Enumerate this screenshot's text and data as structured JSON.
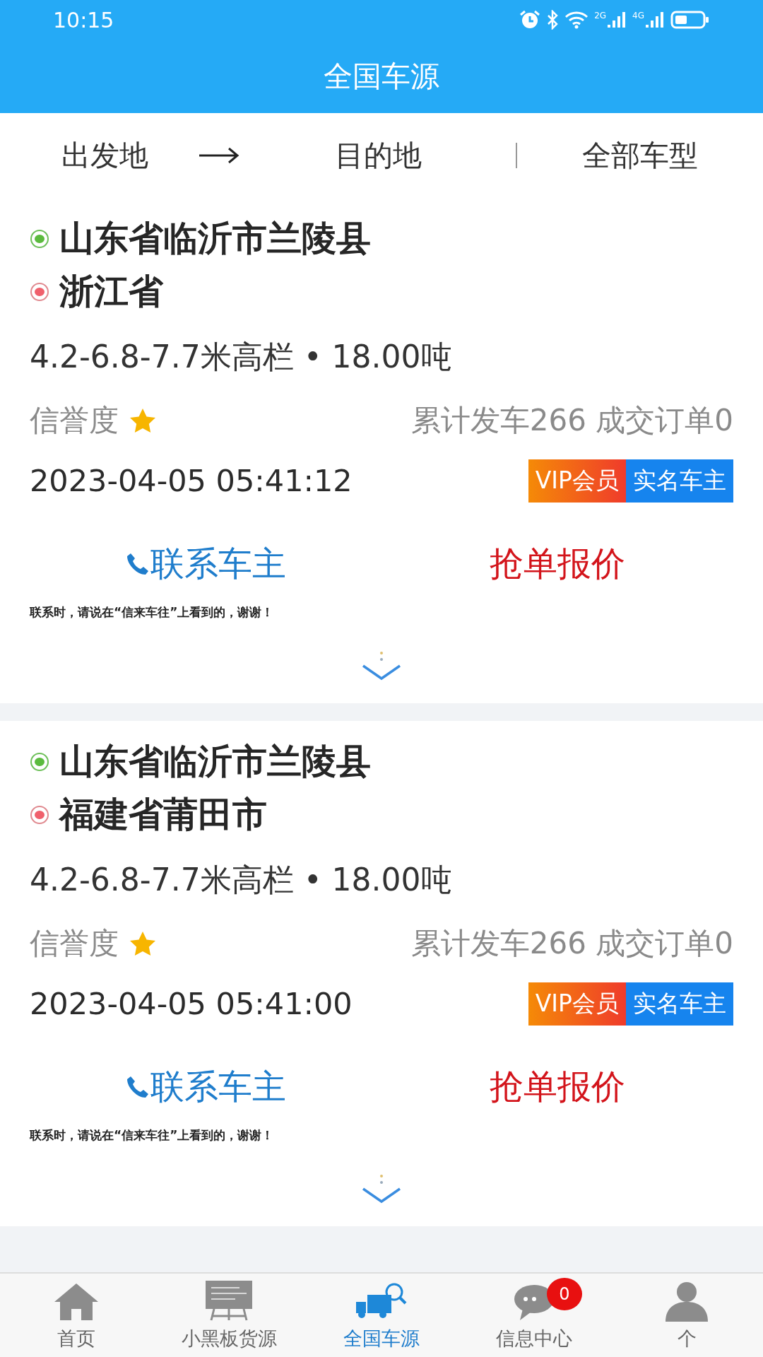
{
  "status_bar": {
    "time": "10:15",
    "network_1": "2G",
    "network_2": "4G"
  },
  "title": "全国车源",
  "filters": {
    "origin": "出发地",
    "destination": "目的地",
    "vehicle_type": "全部车型"
  },
  "listings": [
    {
      "origin": "山东省临沂市兰陵县",
      "destination": "浙江省",
      "spec": "4.2-6.8-7.7米高栏 • 18.00吨",
      "credit_label": "信誉度",
      "stats": "累计发车266 成交订单0",
      "time": "2023-04-05 05:41:12",
      "tags": [
        {
          "label": "VIP会员",
          "kind": "vip"
        },
        {
          "label": "实名车主",
          "kind": "verified"
        }
      ],
      "contact_button": "联系车主",
      "quote_button": "抢单报价",
      "note": "联系时，请说在“信来车往”上看到的，谢谢！"
    },
    {
      "origin": "山东省临沂市兰陵县",
      "destination": "福建省莆田市",
      "spec": "4.2-6.8-7.7米高栏 • 18.00吨",
      "credit_label": "信誉度",
      "stats": "累计发车266 成交订单0",
      "time": "2023-04-05 05:41:00",
      "tags": [
        {
          "label": "VIP会员",
          "kind": "vip"
        },
        {
          "label": "实名车主",
          "kind": "verified"
        }
      ],
      "contact_button": "联系车主",
      "quote_button": "抢单报价",
      "note": "联系时，请说在“信来车往”上看到的，谢谢！"
    }
  ],
  "nav": [
    {
      "label": "首页",
      "kind": "home",
      "selected": false
    },
    {
      "label": "小黑板货源",
      "kind": "board",
      "selected": false
    },
    {
      "label": "全国车源",
      "kind": "truck",
      "selected": true
    },
    {
      "label": "信息中心",
      "kind": "chat",
      "selected": false,
      "badge": "0"
    },
    {
      "label": "个",
      "kind": "person",
      "selected": false
    }
  ]
}
